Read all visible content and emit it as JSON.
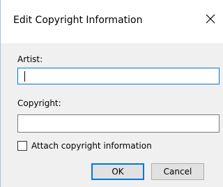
{
  "dialog": {
    "title": "Edit Copyright Information",
    "close_icon": "close-icon"
  },
  "artist": {
    "label": "Artist:",
    "value": ""
  },
  "copyright": {
    "label": "Copyright:",
    "value": ""
  },
  "attach": {
    "label": "Attach copyright information",
    "checked": false
  },
  "buttons": {
    "ok": "OK",
    "cancel": "Cancel"
  },
  "colors": {
    "focus_border": "#0078d7",
    "window_bg": "#f0f0f0",
    "titlebar_bg": "#ffffff"
  }
}
